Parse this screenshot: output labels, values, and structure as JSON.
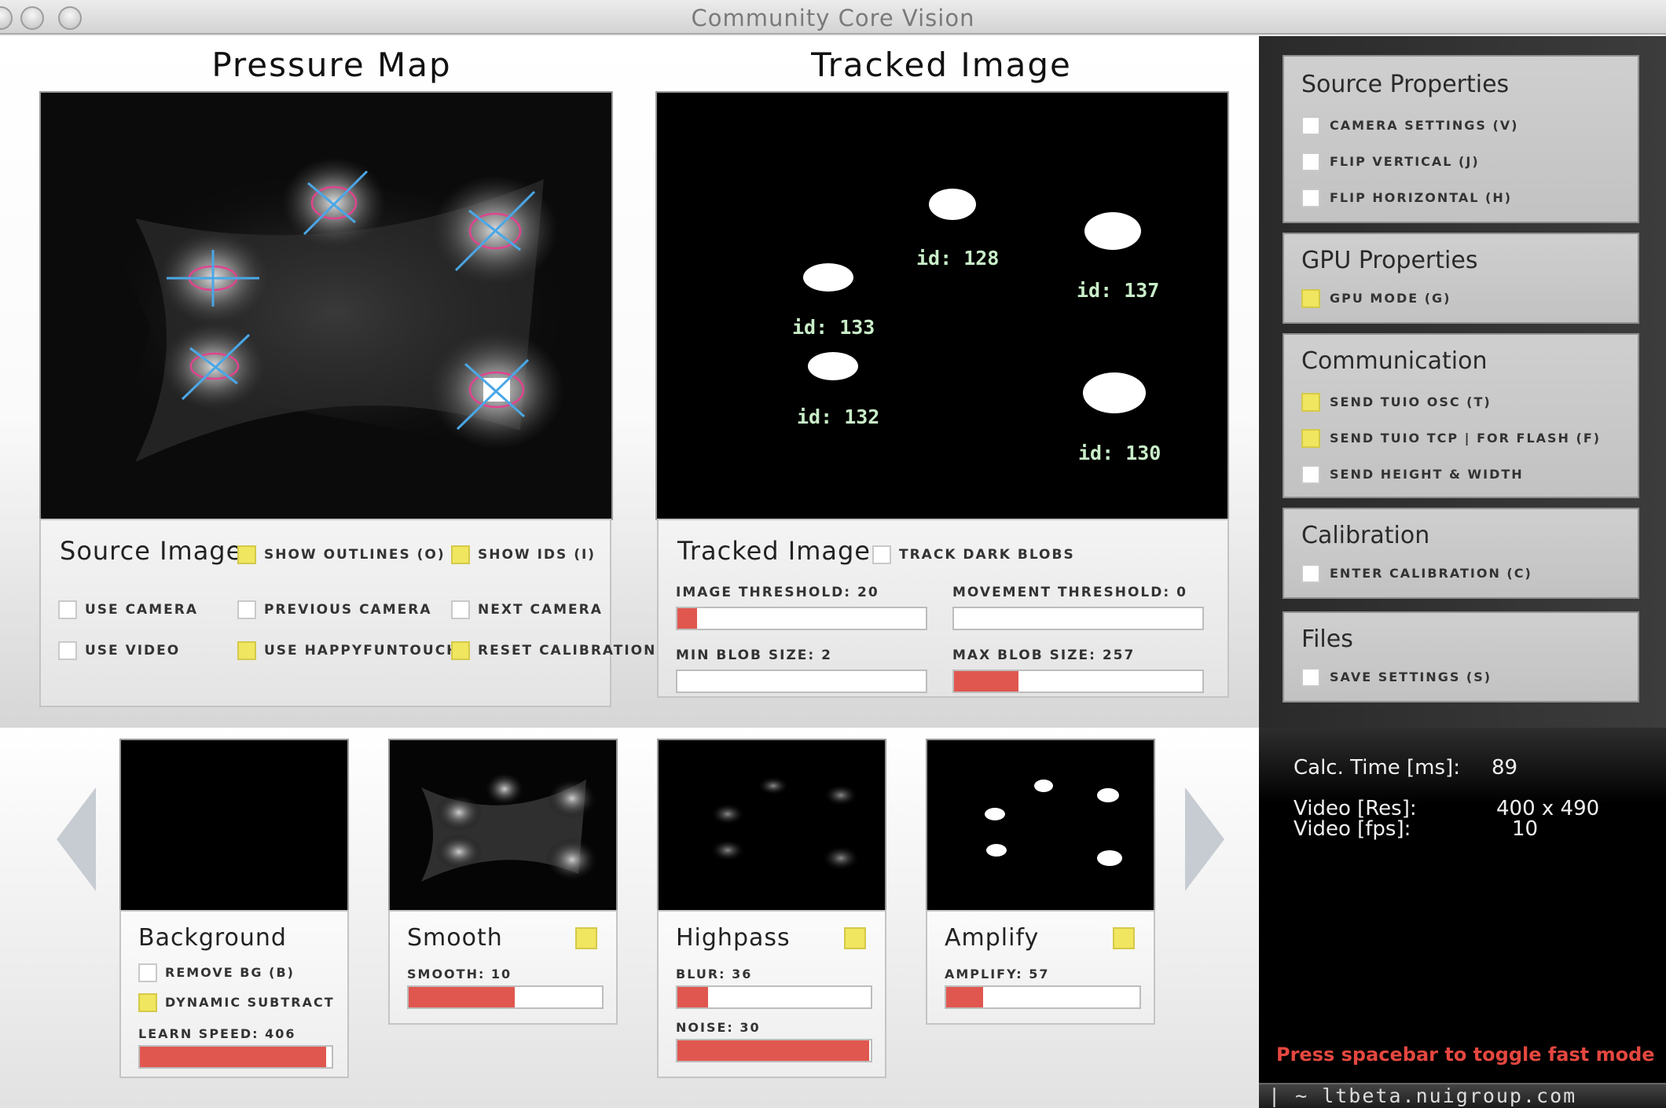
{
  "window": {
    "title": "Community Core Vision"
  },
  "views": {
    "pressure_title": "Pressure Map",
    "tracked_title": "Tracked Image",
    "blob_ids": [
      "id: 128",
      "id: 137",
      "id: 133",
      "id: 132",
      "id: 130"
    ]
  },
  "source_image": {
    "title": "Source Image",
    "show_outlines": "show outlines (o)",
    "show_ids": "show ids (i)",
    "use_camera": "use camera",
    "previous_camera": "previous camera",
    "next_camera": "next camera",
    "use_video": "use video",
    "use_happyfuntouch": "use happyfuntouch",
    "reset_calibration": "reset calibration"
  },
  "tracked_image": {
    "title": "Tracked Image",
    "track_dark_blobs": "track dark blobs",
    "image_threshold": "image threshold: 20",
    "movement_threshold": "movement threshold: 0",
    "min_blob_size": "min blob size: 2",
    "max_blob_size": "max blob size: 257",
    "image_threshold_level": 0.08,
    "movement_threshold_level": 0.0,
    "min_blob_level": 0.0,
    "max_blob_level": 0.26
  },
  "sidebar": {
    "source_properties": {
      "title": "Source Properties",
      "camera_settings": "camera settings (v)",
      "flip_vertical": "flip vertical (j)",
      "flip_horizontal": "flip horizontal (h)"
    },
    "gpu_properties": {
      "title": "GPU Properties",
      "gpu_mode": "gpu mode (g)"
    },
    "communication": {
      "title": "Communication",
      "send_tuio_osc": "send tuio osc (t)",
      "send_tuio_tcp": "send tuio tcp | for flash (f)",
      "send_height_width": "send height & width"
    },
    "calibration": {
      "title": "Calibration",
      "enter_calibration": "enter calibration (c)"
    },
    "files": {
      "title": "Files",
      "save_settings": "save settings (s)"
    }
  },
  "filters": {
    "background": {
      "title": "Background",
      "remove_bg": "remove bg (b)",
      "dynamic_subtract": "dynamic subtract",
      "learn_speed": "learn speed: 406",
      "learn_level": 0.97
    },
    "smooth": {
      "title": "Smooth",
      "smooth": "smooth: 10",
      "smooth_level": 0.55
    },
    "highpass": {
      "title": "Highpass",
      "blur": "blur: 36",
      "blur_level": 0.16,
      "noise": "noise: 30",
      "noise_level": 0.99
    },
    "amplify": {
      "title": "Amplify",
      "amplify": "amplify: 57",
      "amplify_level": 0.19
    }
  },
  "stats": {
    "calc_label": "Calc. Time [ms]:",
    "calc_value": "89",
    "res_label": "Video [Res]:",
    "res_value": "400 x 490",
    "fps_label": "Video [fps]:",
    "fps_value": "10",
    "hint": "Press spacebar to toggle fast mode",
    "url": "| ~ ltbeta.nuigroup.com"
  },
  "colors": {
    "accent_fill": "#e0574f",
    "checkbox_on": "#f0e65f",
    "hint_red": "#e4473f"
  }
}
